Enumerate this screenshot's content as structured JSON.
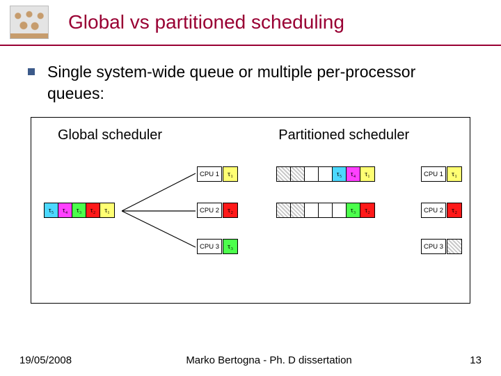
{
  "title": "Global vs partitioned scheduling",
  "bullet": "Single system-wide queue or multiple per-processor queues:",
  "subtitles": {
    "global": "Global scheduler",
    "part": "Partitioned scheduler"
  },
  "tau": {
    "t1": "τ₁",
    "t2": "τ₂",
    "t3": "τ₃",
    "t4": "τ₄",
    "t5": "τ₅"
  },
  "cpu": {
    "c1": "CPU 1",
    "c2": "CPU 2",
    "c3": "CPU 3"
  },
  "footer": {
    "date": "19/05/2008",
    "center": "Marko Bertogna - Ph. D dissertation",
    "page": "13"
  }
}
